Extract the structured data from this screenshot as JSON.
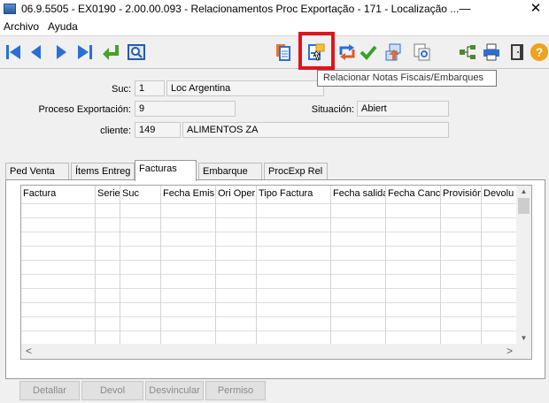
{
  "window": {
    "title": "06.9.5505 - EX0190 - 2.00.00.093 - Relacionamentos Proc Exportação - 171 - Localização ...",
    "minimize_glyph": "—",
    "close_glyph": "✕"
  },
  "menu": {
    "items": [
      "Archivo",
      "Ayuda"
    ]
  },
  "toolbar": {
    "buttons": [
      {
        "icon": "first-record-icon"
      },
      {
        "icon": "previous-record-icon"
      },
      {
        "icon": "next-record-icon"
      },
      {
        "icon": "last-record-icon"
      },
      {
        "icon": "go-to-icon"
      },
      {
        "icon": "zoom-icon"
      },
      {
        "icon": "document-list-icon"
      },
      {
        "icon": "relate-invoices-icon"
      },
      {
        "icon": "relate-icon"
      },
      {
        "icon": "confirm-icon"
      },
      {
        "icon": "copy-link-icon"
      },
      {
        "icon": "document-link-icon"
      },
      {
        "icon": "tree-icon"
      },
      {
        "icon": "print-icon"
      },
      {
        "icon": "exit-icon"
      },
      {
        "icon": "help-icon"
      }
    ],
    "tooltip": "Relacionar Notas Fiscais/Embarques",
    "highlight_color": "#e0141e"
  },
  "form": {
    "suc_label": "Suc:",
    "suc_code": "1",
    "suc_name": "Loc Argentina",
    "proceso_label": "Proceso Exportación:",
    "proceso_value": "9",
    "situacion_label": "Situación:",
    "situacion_value": "Abiert",
    "cliente_label": "cliente:",
    "cliente_code": "149",
    "cliente_name": "ALIMENTOS ZA"
  },
  "tabs": [
    "Ped Venta",
    "Ítems Entreg",
    "Facturas",
    "Embarque",
    "ProcExp Rel"
  ],
  "active_tab": "Facturas",
  "table": {
    "columns": [
      "Factura",
      "Serie",
      "Suc",
      "Fecha Emis",
      "Ori Oper",
      "Tipo Factura",
      "Fecha salida",
      "Fecha Canc",
      "Provisión",
      "Devolu"
    ],
    "rows": []
  },
  "scroll": {
    "left_glyph": "<",
    "right_glyph": ">"
  },
  "actions": [
    "Detallar",
    "Devol",
    "Desvincular",
    "Permiso"
  ]
}
